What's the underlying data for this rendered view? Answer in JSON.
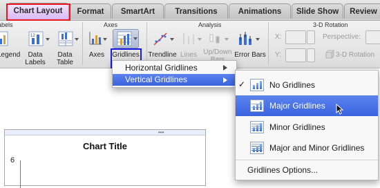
{
  "tabs": [
    {
      "label": "Chart Layout",
      "active": true
    },
    {
      "label": "Format"
    },
    {
      "label": "SmartArt"
    },
    {
      "label": "Transitions"
    },
    {
      "label": "Animations"
    },
    {
      "label": "Slide Show"
    },
    {
      "label": "Review"
    }
  ],
  "ribbon": {
    "groups": {
      "labels": "Labels",
      "axes": "Axes",
      "analysis": "Analysis",
      "rotation": "3-D Rotation"
    },
    "buttons": {
      "legend": "Legend",
      "data_labels": "Data\nLabels",
      "data_table": "Data\nTable",
      "axes": "Axes",
      "gridlines": "Gridlines",
      "trendline": "Trendline",
      "lines": "Lines",
      "updown_bars": "Up/Down\nBars",
      "error_bars": "Error Bars"
    },
    "rotation": {
      "x_label": "X:",
      "y_label": "Y:",
      "perspective_label": "Perspective:",
      "rotation_button": "3-D Rotation"
    }
  },
  "gridlines_menu": {
    "items": [
      {
        "label": "Horizontal Gridlines",
        "selected": false
      },
      {
        "label": "Vertical Gridlines",
        "selected": true
      }
    ]
  },
  "vertical_submenu": {
    "items": [
      {
        "label": "No Gridlines",
        "checked": true,
        "selected": false,
        "icon": "no-gridlines-icon"
      },
      {
        "label": "Major Gridlines",
        "checked": false,
        "selected": true,
        "icon": "major-gridlines-icon"
      },
      {
        "label": "Minor Gridlines",
        "checked": false,
        "selected": false,
        "icon": "minor-gridlines-icon"
      },
      {
        "label": "Major and Minor Gridlines",
        "checked": false,
        "selected": false,
        "icon": "major-minor-gridlines-icon"
      }
    ],
    "options": "Gridlines Options...",
    "checkmark": "✓"
  },
  "chart": {
    "title": "Chart Title",
    "y_tick": "6"
  },
  "colors": {
    "menu_selected": "#3f67e0",
    "highlight_red": "#e8181e",
    "highlight_blue": "#1a1ae0",
    "active_tab": "#d9b7f4"
  }
}
